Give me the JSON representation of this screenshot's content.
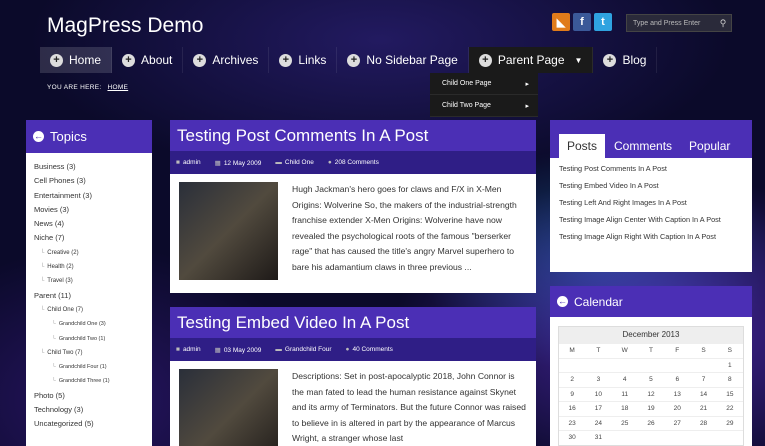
{
  "header": {
    "site_title": "MagPress Demo",
    "social": [
      {
        "name": "rss-icon",
        "glyph": "◣",
        "color": "#e07b1a"
      },
      {
        "name": "facebook-icon",
        "glyph": "f",
        "color": "#3b5998"
      },
      {
        "name": "twitter-icon",
        "glyph": "t",
        "color": "#2fa3e0"
      }
    ],
    "search_placeholder": "Type and Press Enter"
  },
  "nav": {
    "home": "Home",
    "about": "About",
    "archives": "Archives",
    "links": "Links",
    "no_sidebar": "No Sidebar Page",
    "parent": "Parent Page",
    "blog": "Blog",
    "dropdown": [
      "Child One Page",
      "Child Two Page"
    ]
  },
  "breadcrumb": {
    "label": "YOU ARE HERE:",
    "current": "HOME"
  },
  "topics": {
    "title": "Topics",
    "items": [
      {
        "text": "Business (3)",
        "level": 1
      },
      {
        "text": "Cell Phones (3)",
        "level": 1
      },
      {
        "text": "Entertainment (3)",
        "level": 1
      },
      {
        "text": "Movies (3)",
        "level": 1
      },
      {
        "text": "News (4)",
        "level": 1
      },
      {
        "text": "Niche (7)",
        "level": 1
      },
      {
        "text": "Creative (2)",
        "level": 2
      },
      {
        "text": "Health (2)",
        "level": 2
      },
      {
        "text": "Travel (3)",
        "level": 2
      },
      {
        "text": "Parent (11)",
        "level": 1
      },
      {
        "text": "Child One (7)",
        "level": 2
      },
      {
        "text": "Grandchild One (3)",
        "level": 3
      },
      {
        "text": "Grandchild Two (1)",
        "level": 3
      },
      {
        "text": "Child Two (7)",
        "level": 2
      },
      {
        "text": "Grandchild Four (1)",
        "level": 3
      },
      {
        "text": "Grandchild Three (1)",
        "level": 3
      },
      {
        "text": "Photo (5)",
        "level": 1
      },
      {
        "text": "Technology (3)",
        "level": 1
      },
      {
        "text": "Uncategorized (5)",
        "level": 1
      }
    ]
  },
  "posts": [
    {
      "title": "Testing Post Comments In A Post",
      "author": "admin",
      "date": "12 May 2009",
      "category": "Child One",
      "comments": "208 Comments",
      "excerpt": "Hugh Jackman's hero goes for claws and F/X in X-Men Origins: Wolverine So, the makers of the industrial-strength franchise extender X-Men Origins: Wolverine have now revealed the psychological roots of the famous \"berserker rage\" that has caused the title's angry Marvel superhero to bare his adamantium claws in three previous ..."
    },
    {
      "title": "Testing Embed Video In A Post",
      "author": "admin",
      "date": "03 May 2009",
      "category": "Grandchild Four",
      "comments": "40 Comments",
      "excerpt": "Descriptions: Set in post-apocalyptic 2018, John Connor is the man fated to lead the human resistance against Skynet and its army of Terminators. But the future Connor was raised to believe in is altered in part by the appearance of Marcus Wright, a stranger whose last"
    }
  ],
  "tabs_widget": {
    "tabs": [
      "Posts",
      "Comments",
      "Popular"
    ],
    "posts": [
      "Testing Post Comments In A Post",
      "Testing Embed Video In A Post",
      "Testing Left And Right Images In A Post",
      "Testing Image Align Center With Caption In A Post",
      "Testing Image Align Right With Caption In A Post"
    ]
  },
  "calendar": {
    "title": "Calendar",
    "month": "December 2013",
    "days": [
      "M",
      "T",
      "W",
      "T",
      "F",
      "S",
      "S"
    ],
    "dates": [
      "",
      "",
      "",
      "",
      "",
      "",
      "1",
      "2",
      "3",
      "4",
      "5",
      "6",
      "7",
      "8",
      "9",
      "10",
      "11",
      "12",
      "13",
      "14",
      "15",
      "16",
      "17",
      "18",
      "19",
      "20",
      "21",
      "22",
      "23",
      "24",
      "25",
      "26",
      "27",
      "28",
      "29",
      "30",
      "31",
      "",
      "",
      "",
      "",
      ""
    ]
  },
  "colors": {
    "accent": "#4b2fb5",
    "meta_bar": "#2f1e86",
    "background": "#0b0a2a"
  }
}
